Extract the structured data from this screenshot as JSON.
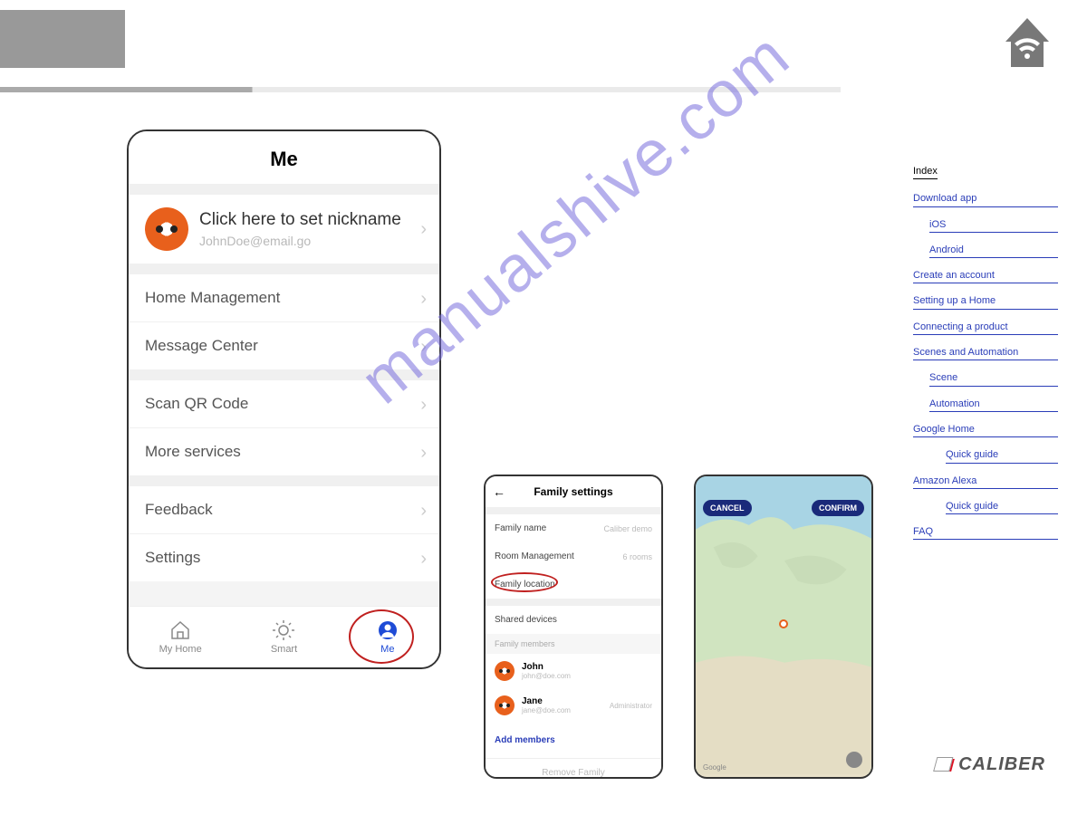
{
  "watermark": "manualshive.com",
  "phone1": {
    "title": "Me",
    "nickname_prompt": "Click here to set nickname",
    "email": "JohnDoe@email.go",
    "rows": {
      "home_mgmt": "Home Management",
      "msg_center": "Message Center",
      "scan_qr": "Scan QR Code",
      "more_svc": "More services",
      "feedback": "Feedback",
      "settings": "Settings"
    },
    "tabs": {
      "home": "My Home",
      "smart": "Smart",
      "me": "Me"
    }
  },
  "phone2": {
    "title": "Family settings",
    "rows": {
      "family_name": {
        "label": "Family name",
        "value": "Caliber demo"
      },
      "room_mgmt": {
        "label": "Room Management",
        "value": "6 rooms"
      },
      "family_loc": {
        "label": "Family location",
        "value": ""
      },
      "shared": {
        "label": "Shared devices",
        "value": ""
      }
    },
    "section": "Family members",
    "members": [
      {
        "name": "John",
        "email": "john@doe.com",
        "role": ""
      },
      {
        "name": "Jane",
        "email": "jane@doe.com",
        "role": "Administrator"
      }
    ],
    "add": "Add members",
    "remove": "Remove Family"
  },
  "phone3": {
    "cancel": "CANCEL",
    "confirm": "CONFIRM",
    "attribution": "Google"
  },
  "toc": {
    "head": "Index",
    "items": [
      {
        "label": "Download app",
        "indent": 0
      },
      {
        "label": "iOS",
        "indent": 1
      },
      {
        "label": "Android",
        "indent": 1
      },
      {
        "label": "Create an account",
        "indent": 0
      },
      {
        "label": "Setting up a Home",
        "indent": 0
      },
      {
        "label": "Connecting a product",
        "indent": 0
      },
      {
        "label": "Scenes and Automation",
        "indent": 0
      },
      {
        "label": "Scene",
        "indent": 1
      },
      {
        "label": "Automation",
        "indent": 1
      },
      {
        "label": "Google Home",
        "indent": 0
      },
      {
        "label": "Quick guide",
        "indent": 2
      },
      {
        "label": "Amazon Alexa",
        "indent": 0
      },
      {
        "label": "Quick guide",
        "indent": 2
      },
      {
        "label": "FAQ",
        "indent": 0
      }
    ]
  },
  "brand": "CALIBER"
}
